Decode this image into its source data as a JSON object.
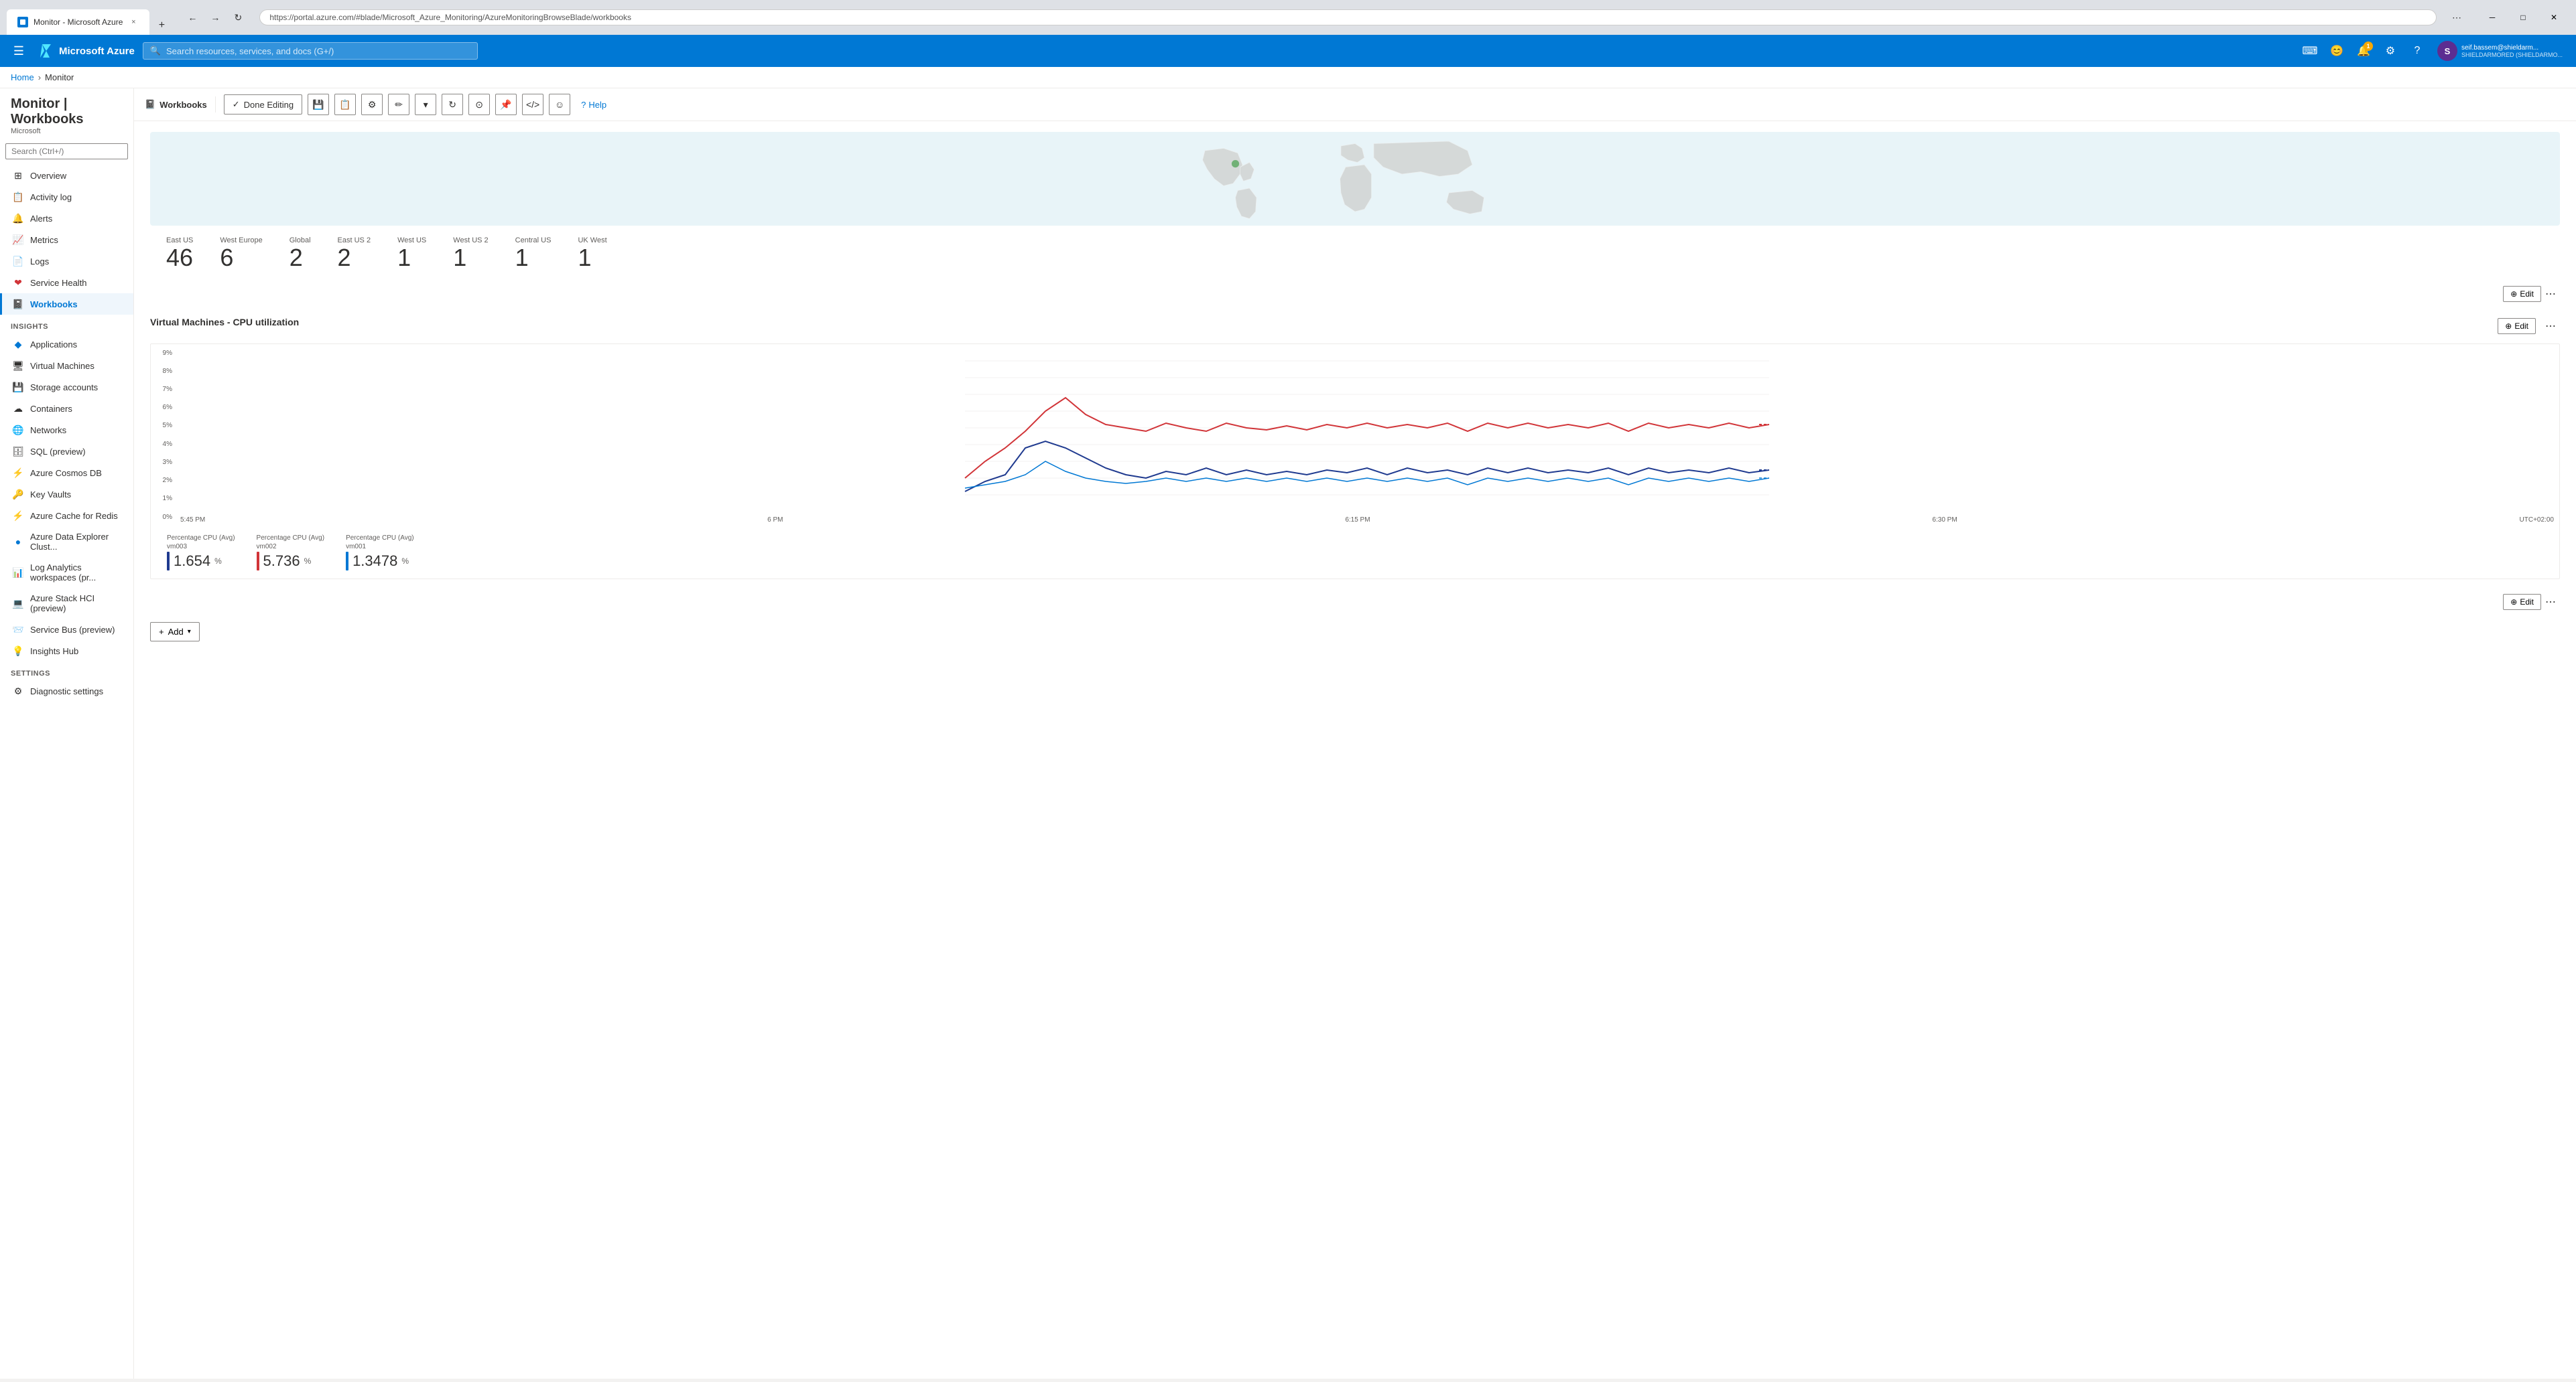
{
  "browser": {
    "tab_label": "Monitor - Microsoft Azure",
    "url": "https://portal.azure.com/#blade/Microsoft_Azure_Monitoring/AzureMonitoringBrowseBlade/workbooks",
    "close_label": "×",
    "newtab_label": "+"
  },
  "topbar": {
    "hamburger_icon": "☰",
    "logo_text": "Microsoft Azure",
    "search_placeholder": "Search resources, services, and docs (G+/)",
    "notification_count": "1",
    "user_initials": "S",
    "user_name": "seif.bassem@shieldarm...",
    "user_tenant": "SHIELDARMORED (SHIELDARMO..."
  },
  "breadcrumb": {
    "home": "Home",
    "current": "Monitor"
  },
  "page": {
    "title": "Monitor | Workbooks",
    "subtitle": "Microsoft",
    "pin_icon": "📌",
    "more_icon": "..."
  },
  "toolbar": {
    "workbooks_label": "Workbooks",
    "done_editing_label": "Done Editing",
    "save_icon": "💾",
    "copy_icon": "📋",
    "settings_icon": "⚙",
    "edit_icon": "✏",
    "dropdown_icon": "▾",
    "refresh_icon": "↻",
    "share_icon": "⊙",
    "pin_icon": "📌",
    "code_icon": "</>",
    "smile_icon": "☺",
    "help_label": "Help",
    "help_icon": "?"
  },
  "sidebar": {
    "search_placeholder": "Search (Ctrl+/)",
    "collapse_icon": "«",
    "nav_items": [
      {
        "id": "overview",
        "label": "Overview",
        "icon": "⊞"
      },
      {
        "id": "activity-log",
        "label": "Activity log",
        "icon": "📋"
      },
      {
        "id": "alerts",
        "label": "Alerts",
        "icon": "🔔"
      },
      {
        "id": "metrics",
        "label": "Metrics",
        "icon": "📈"
      },
      {
        "id": "logs",
        "label": "Logs",
        "icon": "📄"
      },
      {
        "id": "service-health",
        "label": "Service Health",
        "icon": "❤"
      },
      {
        "id": "workbooks",
        "label": "Workbooks",
        "icon": "📓",
        "active": true
      }
    ],
    "insights_section": "Insights",
    "insights_items": [
      {
        "id": "applications",
        "label": "Applications",
        "icon": "◆"
      },
      {
        "id": "virtual-machines",
        "label": "Virtual Machines",
        "icon": "🖥"
      },
      {
        "id": "storage-accounts",
        "label": "Storage accounts",
        "icon": "💾"
      },
      {
        "id": "containers",
        "label": "Containers",
        "icon": "☁"
      },
      {
        "id": "networks",
        "label": "Networks",
        "icon": "🌐"
      },
      {
        "id": "sql-preview",
        "label": "SQL (preview)",
        "icon": "🗄"
      },
      {
        "id": "cosmos-db",
        "label": "Azure Cosmos DB",
        "icon": "⚡"
      },
      {
        "id": "key-vaults",
        "label": "Key Vaults",
        "icon": "🔑"
      },
      {
        "id": "cache-redis",
        "label": "Azure Cache for Redis",
        "icon": "⚡"
      },
      {
        "id": "data-explorer",
        "label": "Azure Data Explorer Clust...",
        "icon": "🔵"
      },
      {
        "id": "log-analytics",
        "label": "Log Analytics workspaces (pr...",
        "icon": "📊"
      },
      {
        "id": "stack-hci",
        "label": "Azure Stack HCI (preview)",
        "icon": "💻"
      },
      {
        "id": "service-bus",
        "label": "Service Bus (preview)",
        "icon": "📨"
      },
      {
        "id": "insights-hub",
        "label": "Insights Hub",
        "icon": "💡"
      }
    ],
    "settings_section": "Settings",
    "settings_items": [
      {
        "id": "diagnostic-settings",
        "label": "Diagnostic settings",
        "icon": "⚙"
      }
    ]
  },
  "map": {
    "dot_color": "#107c10"
  },
  "stats": [
    {
      "label": "East US",
      "value": "46"
    },
    {
      "label": "West Europe",
      "value": "6"
    },
    {
      "label": "Global",
      "value": "2"
    },
    {
      "label": "East US 2",
      "value": "2"
    },
    {
      "label": "West US",
      "value": "1"
    },
    {
      "label": "West US 2",
      "value": "1"
    },
    {
      "label": "Central US",
      "value": "1"
    },
    {
      "label": "UK West",
      "value": "1"
    }
  ],
  "chart": {
    "title": "Virtual Machines - CPU utilization",
    "edit_label": "⊕ Edit",
    "more_icon": "⋯",
    "y_labels": [
      "9%",
      "8%",
      "7%",
      "6%",
      "5%",
      "4%",
      "3%",
      "2%",
      "1%",
      "0%"
    ],
    "x_labels": [
      "5:45 PM",
      "6 PM",
      "6:15 PM",
      "6:30 PM",
      "UTC+02:00"
    ],
    "legend": [
      {
        "color": "#1f3a8f",
        "label_line1": "Percentage CPU (Avg)",
        "label_line2": "vm003",
        "value": "1.654",
        "unit": "%"
      },
      {
        "color": "#d13438",
        "label_line1": "Percentage CPU (Avg)",
        "label_line2": "vm002",
        "value": "5.736",
        "unit": "%"
      },
      {
        "color": "#0078d4",
        "label_line1": "Percentage CPU (Avg)",
        "label_line2": "vm001",
        "value": "1.3478",
        "unit": "%"
      }
    ]
  },
  "add_section": {
    "icon": "+",
    "label": "Add",
    "chevron": "▾"
  }
}
